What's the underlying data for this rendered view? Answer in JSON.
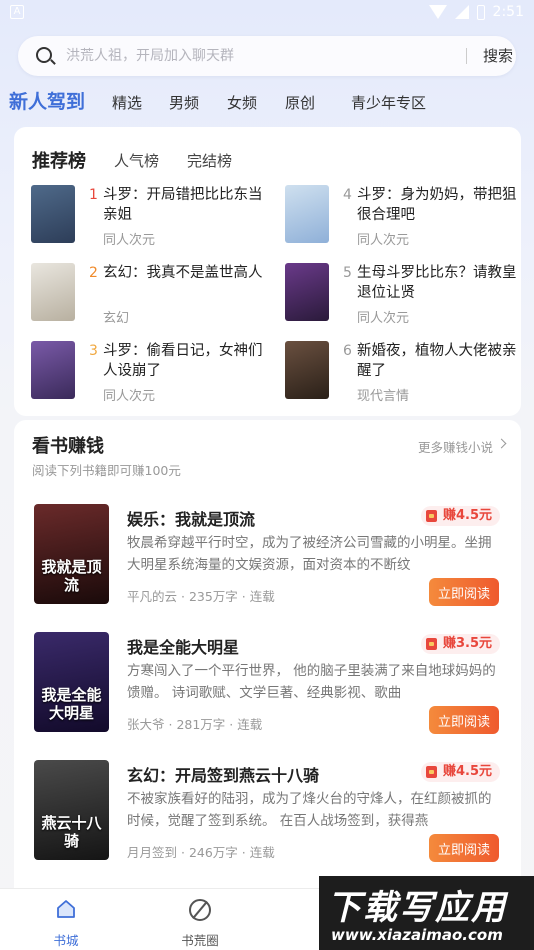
{
  "status_bar": {
    "time": "2:51",
    "app_indicator": "A"
  },
  "search": {
    "placeholder": "洪荒人祖，开局加入聊天群",
    "button_label": "搜索"
  },
  "top_tabs": [
    {
      "label": "新人驾到",
      "active": true
    },
    {
      "label": "精选"
    },
    {
      "label": "男频"
    },
    {
      "label": "女频"
    },
    {
      "label": "原创"
    },
    {
      "label": "青少年专区"
    }
  ],
  "rank_section": {
    "tabs": [
      {
        "label": "推荐榜",
        "active": true
      },
      {
        "label": "人气榜"
      },
      {
        "label": "完结榜"
      }
    ],
    "items": [
      {
        "rank": "1",
        "title": "斗罗：开局错把比比东当亲姐",
        "category": "同人次元",
        "rank_color": "#e8473c",
        "cover_colors": [
          "#4f6a8a",
          "#2d3d58"
        ]
      },
      {
        "rank": "2",
        "title": "玄幻：我真不是盖世高人",
        "category": "玄幻",
        "rank_color": "#f08a2a",
        "cover_colors": [
          "#e9e6df",
          "#b8b0a0"
        ]
      },
      {
        "rank": "3",
        "title": "斗罗：偷看日记，女神们人设崩了",
        "category": "同人次元",
        "rank_color": "#f0a840",
        "cover_colors": [
          "#7a5aa8",
          "#3a2a5a"
        ]
      },
      {
        "rank": "4",
        "title": "斗罗：身为奶妈，带把狙很合理吧",
        "category": "同人次元",
        "rank_color": "#999999",
        "cover_colors": [
          "#cfe0ef",
          "#8fb0d8"
        ]
      },
      {
        "rank": "5",
        "title": "生母斗罗比比东？请教皇退位让贤",
        "category": "同人次元",
        "rank_color": "#999999",
        "cover_colors": [
          "#6a3a8a",
          "#2a1a3a"
        ]
      },
      {
        "rank": "6",
        "title": "新婚夜，植物人大佬被亲醒了",
        "category": "现代言情",
        "rank_color": "#999999",
        "cover_colors": [
          "#6a5040",
          "#2a2018"
        ]
      }
    ]
  },
  "earn_section": {
    "title": "看书赚钱",
    "subtitle": "阅读下列书籍即可赚100元",
    "more_label": "更多赚钱小说",
    "books": [
      {
        "title": "娱乐：我就是顶流",
        "description": "牧晨希穿越平行时空，成为了被经济公司雪藏的小明星。坐拥大明星系统海量的文娱资源，面对资本的不断纹",
        "author": "平凡的云",
        "words": "235万字",
        "status": "连载",
        "reward": "赚4.5元",
        "button_label": "立即阅读",
        "cover_colors": [
          "#6a2a2a",
          "#1a0a0a"
        ],
        "cover_text": "我就是顶流"
      },
      {
        "title": "我是全能大明星",
        "description": "方寒闯入了一个平行世界， 他的脑子里装满了来自地球妈妈的馈赠。 诗词歌赋、文学巨著、经典影视、歌曲",
        "author": "张大爷",
        "words": "281万字",
        "status": "连载",
        "reward": "赚3.5元",
        "button_label": "立即阅读",
        "cover_colors": [
          "#3a2a6a",
          "#120a2a"
        ],
        "cover_text": "我是全能大明星"
      },
      {
        "title": "玄幻：开局签到燕云十八骑",
        "description": "不被家族看好的陆羽，成为了烽火台的守烽人，在红颜被抓的时候，觉醒了签到系统。 在百人战场签到，获得燕",
        "author": "月月签到",
        "words": "246万字",
        "status": "连载",
        "reward": "赚4.5元",
        "button_label": "立即阅读",
        "cover_colors": [
          "#4a4a4a",
          "#151515"
        ],
        "cover_text": "燕云十八骑"
      }
    ]
  },
  "bottom_nav": [
    {
      "label": "书城",
      "active": true,
      "icon": "home-icon"
    },
    {
      "label": "书荒圈",
      "active": false,
      "icon": "compass-icon"
    }
  ],
  "watermark": {
    "main": "下载写应用",
    "url": "www.xiazaimao.com"
  },
  "colors": {
    "accent": "#3f6fd8",
    "reward_red": "#e8473c",
    "button_orange": "#ef5a2e"
  }
}
